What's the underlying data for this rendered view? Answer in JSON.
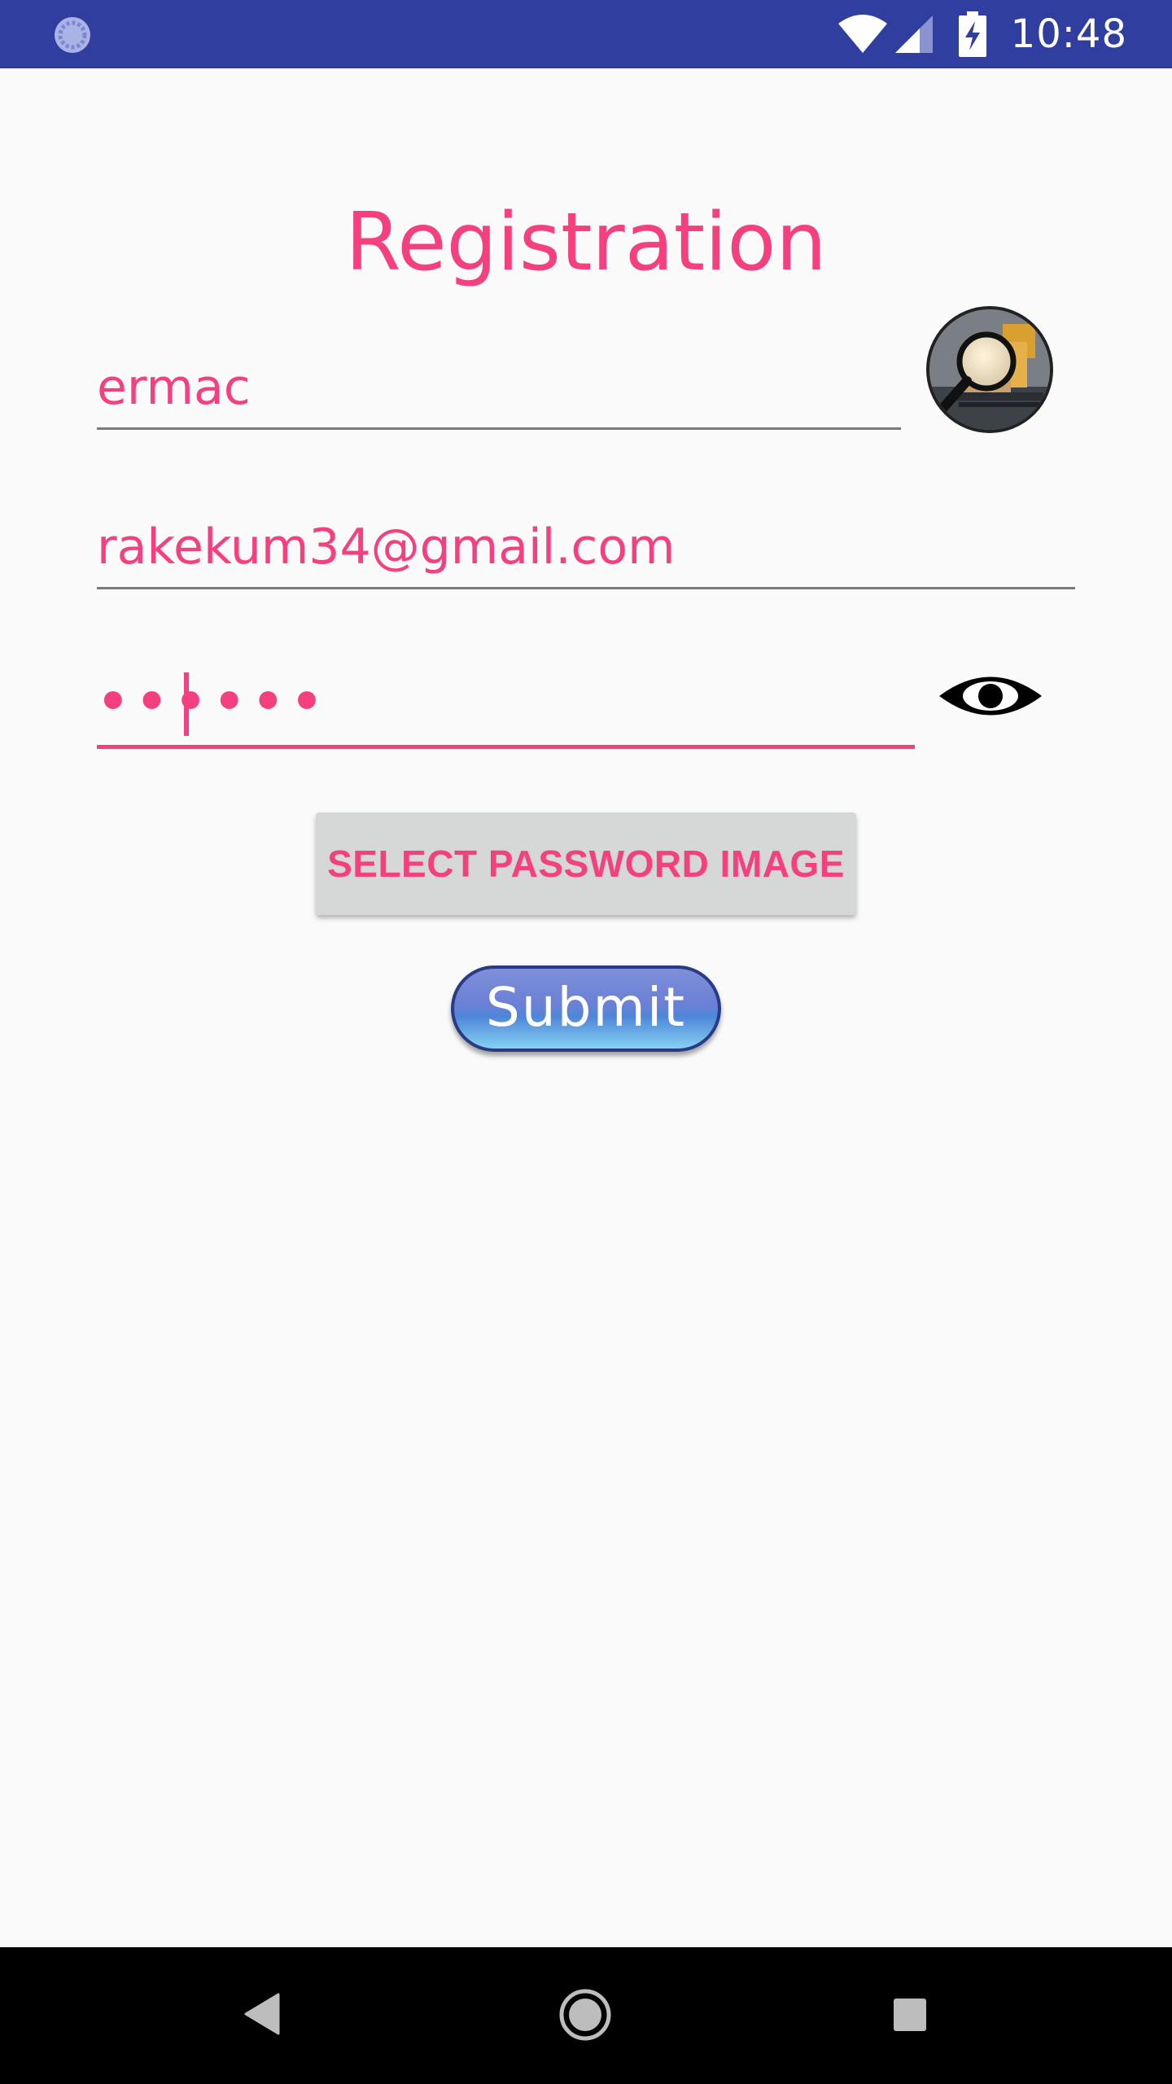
{
  "status_bar": {
    "time": "10:48",
    "icons": [
      "loading-icon",
      "wifi-icon",
      "signal-icon",
      "battery-charging-icon"
    ]
  },
  "form": {
    "title": "Registration",
    "username_value": "ermac",
    "email_value": "rakekum34@gmail.com",
    "password_masked": "••••••",
    "select_image_label": "SELECT PASSWORD IMAGE",
    "submit_label": "Submit",
    "avatar_icon": "image-search-icon",
    "visibility_icon": "eye-icon"
  },
  "nav_bar": {
    "icons": [
      "back-icon",
      "home-icon",
      "recents-icon"
    ]
  },
  "colors": {
    "status_bar": "#303f9f",
    "accent": "#f4407f",
    "background": "#fafafa",
    "button_gray": "#d6d7d7",
    "nav_bar": "#000000"
  }
}
